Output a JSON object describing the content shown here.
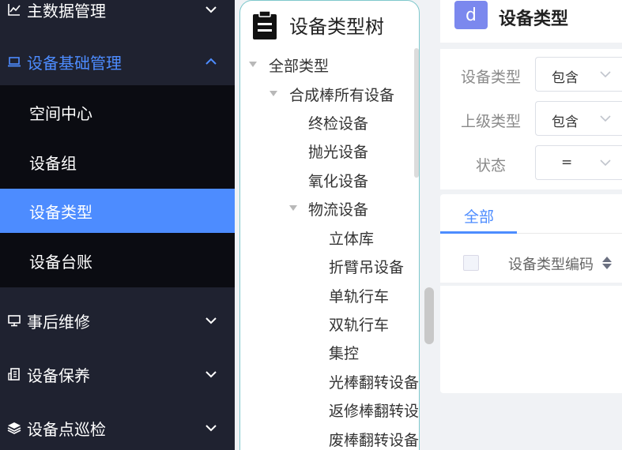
{
  "sidebar": {
    "items": [
      {
        "label": "主数据管理",
        "icon": "line-chart-icon"
      },
      {
        "label": "设备基础管理",
        "icon": "laptop-icon"
      },
      {
        "label": "事后维修",
        "icon": "desktop-icon"
      },
      {
        "label": "设备保养",
        "icon": "building-icon"
      },
      {
        "label": "设备点巡检",
        "icon": "layers-icon"
      }
    ],
    "submenu": [
      "空间中心",
      "设备组",
      "设备类型",
      "设备台账"
    ],
    "selected_index": 2,
    "active_color": "#4d8cff",
    "background": "#1f2230"
  },
  "tree": {
    "title": "设备类型树",
    "icon": "clipboard-icon",
    "nodes": [
      {
        "label": "全部类型"
      },
      {
        "label": "合成棒所有设备"
      },
      {
        "label": "终检设备"
      },
      {
        "label": "抛光设备"
      },
      {
        "label": "氧化设备"
      },
      {
        "label": "物流设备"
      },
      {
        "label": "立体库"
      },
      {
        "label": "折臂吊设备"
      },
      {
        "label": "单轨行车"
      },
      {
        "label": "双轨行车"
      },
      {
        "label": "集控"
      },
      {
        "label": "光棒翻转设备"
      },
      {
        "label": "返修棒翻转设备"
      },
      {
        "label": "废棒翻转设备"
      }
    ]
  },
  "header": {
    "badge_letter": "d",
    "badge_color": "#7b88ee",
    "title": "设备类型"
  },
  "filters": [
    {
      "label": "设备类型",
      "operator": "包含"
    },
    {
      "label": "上级类型",
      "operator": "包含"
    },
    {
      "label": "状态",
      "operator": "="
    }
  ],
  "tabs": [
    {
      "label": "全部"
    }
  ],
  "table": {
    "columns": [
      {
        "label": "设备类型编码"
      }
    ]
  }
}
